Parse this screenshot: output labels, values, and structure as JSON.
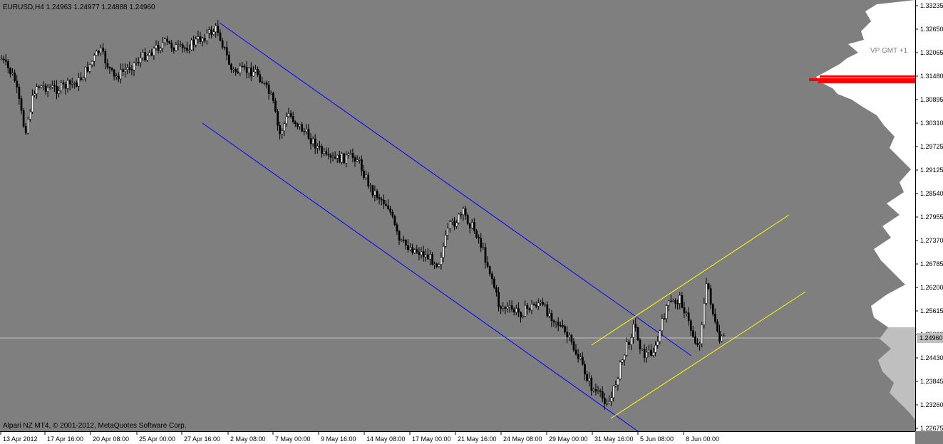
{
  "header": {
    "symbol_timeframe": "EURUSD,H4",
    "ohlc": "1.24963 1.24977 1.24888 1.24960"
  },
  "footer_copyright": "Alpari NZ MT4, © 2001-2012, MetaQuotes Software Corp.",
  "volume_profile_label": "VP GMT +1",
  "current_price_label": "1.24960",
  "price_scale": [
    "1.33235",
    "1.32650",
    "1.32065",
    "1.31480",
    "1.30895",
    "1.30310",
    "1.29725",
    "1.29125",
    "1.28540",
    "1.27955",
    "1.27370",
    "1.26785",
    "1.26200",
    "1.25615",
    "1.25030",
    "1.24430",
    "1.23845",
    "1.23260",
    "1.22675"
  ],
  "time_scale": [
    "13 Apr 2012",
    "17 Apr 16:00",
    "20 Apr 08:00",
    "25 Apr 00:00",
    "27 Apr 16:00",
    "2 May 08:00",
    "7 May 00:00",
    "9 May 16:00",
    "14 May 08:00",
    "17 May 00:00",
    "21 May 16:00",
    "24 May 08:00",
    "29 May 00:00",
    "31 May 16:00",
    "5 Jun 08:00",
    "8 Jun 00:00"
  ],
  "colors": {
    "background": "#7f7f7f",
    "candle": "#000000",
    "down_channel": "#0000ff",
    "up_channel": "#ffff00",
    "volume_profile_light": "#ffffff",
    "volume_profile_shade": "#bfbfbf",
    "poc": "#ff0000",
    "price_line": "#c0c0c0"
  }
}
